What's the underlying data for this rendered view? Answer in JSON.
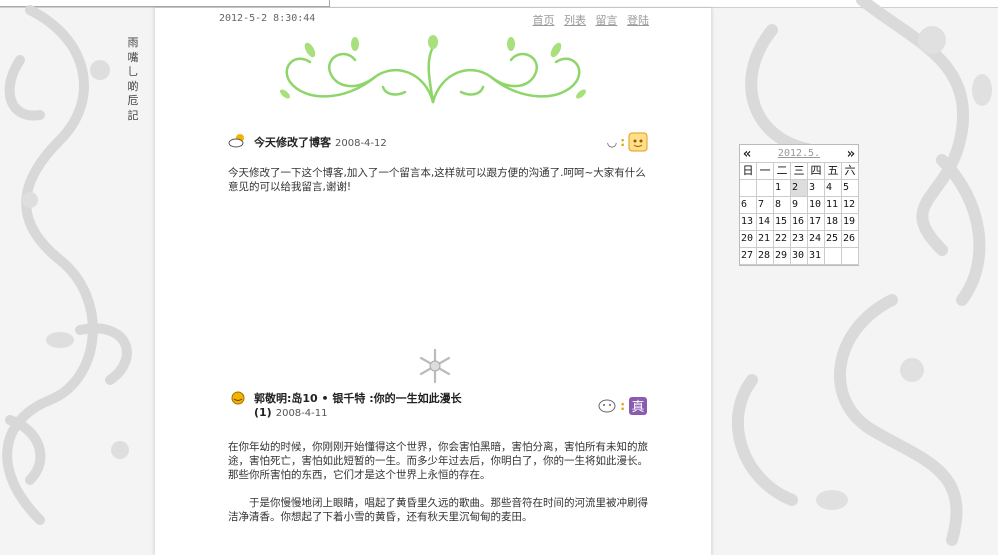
{
  "blog": {
    "vertical_title": "雨嘴乚啲卮記",
    "datetime": "2012-5-2  8:30:44",
    "nav": [
      "首页",
      "列表",
      "留言",
      "登陆"
    ]
  },
  "posts": [
    {
      "title": "今天修改了博客",
      "date": "2008-4-12",
      "weather_icon": "cloudy-sun-icon",
      "mood_label": "◡",
      "mood_icon": "face-icon",
      "paragraphs": [
        "今天修改了一下这个博客,加入了一个留言本,这样就可以跟方便的沟通了.呵呵~大家有什么意见的可以给我留言,谢谢!"
      ]
    },
    {
      "title": "郭敬明:岛10 • 银千特  :你的一生如此漫长(1)",
      "date": "2008-4-11",
      "weather_icon": "sunny-icon",
      "mood_label": "",
      "mood_icon": "true-icon",
      "paragraphs": [
        "在你年幼的时候，你刚刚开始懂得这个世界，你会害怕黑暗，害怕分离，害怕所有未知的旅途，害怕死亡，害怕如此短暂的一生。而多少年过去后，你明白了，你的一生将如此漫长。那些你所害怕的东西，它们才是这个世界上永恒的存在。",
        "　　于是你慢慢地闭上眼睛，唱起了黄昏里久远的歌曲。那些音符在时间的河流里被冲刷得洁净清香。你想起了下着小雪的黄昏，还有秋天里沉甸甸的麦田。"
      ]
    }
  ],
  "calendar": {
    "month_label": "2012.5.",
    "prev": "«",
    "next": "»",
    "weekdays": [
      "日",
      "一",
      "二",
      "三",
      "四",
      "五",
      "六"
    ],
    "days": [
      "",
      "",
      "1",
      "2",
      "3",
      "4",
      "5",
      "6",
      "7",
      "8",
      "9",
      "10",
      "11",
      "12",
      "13",
      "14",
      "15",
      "16",
      "17",
      "18",
      "19",
      "20",
      "21",
      "22",
      "23",
      "24",
      "25",
      "26",
      "27",
      "28",
      "29",
      "30",
      "31",
      "",
      ""
    ],
    "today": "2"
  },
  "colors": {
    "ornament": "#8ed66a",
    "mood_orange": "#f0a020",
    "mood_purple": "#8a5bb0"
  }
}
